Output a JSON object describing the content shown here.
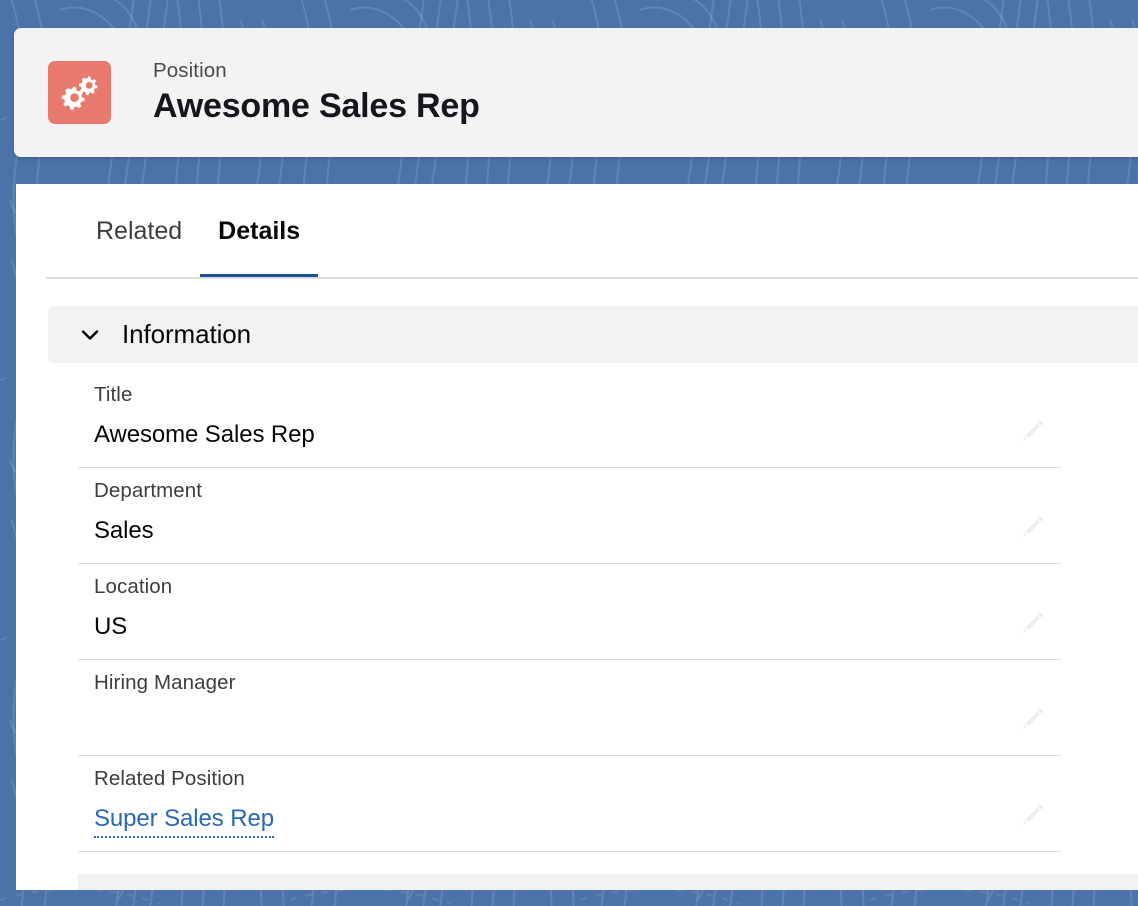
{
  "colors": {
    "backdrop_blue": "#4b72a9",
    "record_icon_bg": "#e8796f",
    "tab_active_underline": "#1b5297",
    "link_blue": "#2a68b7",
    "section_header_bg": "#f3f2f2",
    "divider": "#dddbda"
  },
  "header": {
    "icon_name": "gears-icon",
    "record_type": "Position",
    "record_title": "Awesome Sales Rep"
  },
  "tabs": [
    {
      "label": "Related",
      "active": false
    },
    {
      "label": "Details",
      "active": true
    }
  ],
  "section": {
    "chevron_icon": "chevron-down-icon",
    "title": "Information"
  },
  "fields": [
    {
      "label": "Title",
      "value": "Awesome Sales Rep",
      "is_link": false,
      "edit_icon": "pencil-icon"
    },
    {
      "label": "Department",
      "value": "Sales",
      "is_link": false,
      "edit_icon": "pencil-icon"
    },
    {
      "label": "Location",
      "value": "US",
      "is_link": false,
      "edit_icon": "pencil-icon"
    },
    {
      "label": "Hiring Manager",
      "value": "",
      "is_link": false,
      "edit_icon": "pencil-icon"
    },
    {
      "label": "Related Position",
      "value": "Super Sales Rep",
      "is_link": true,
      "edit_icon": "pencil-icon"
    }
  ]
}
